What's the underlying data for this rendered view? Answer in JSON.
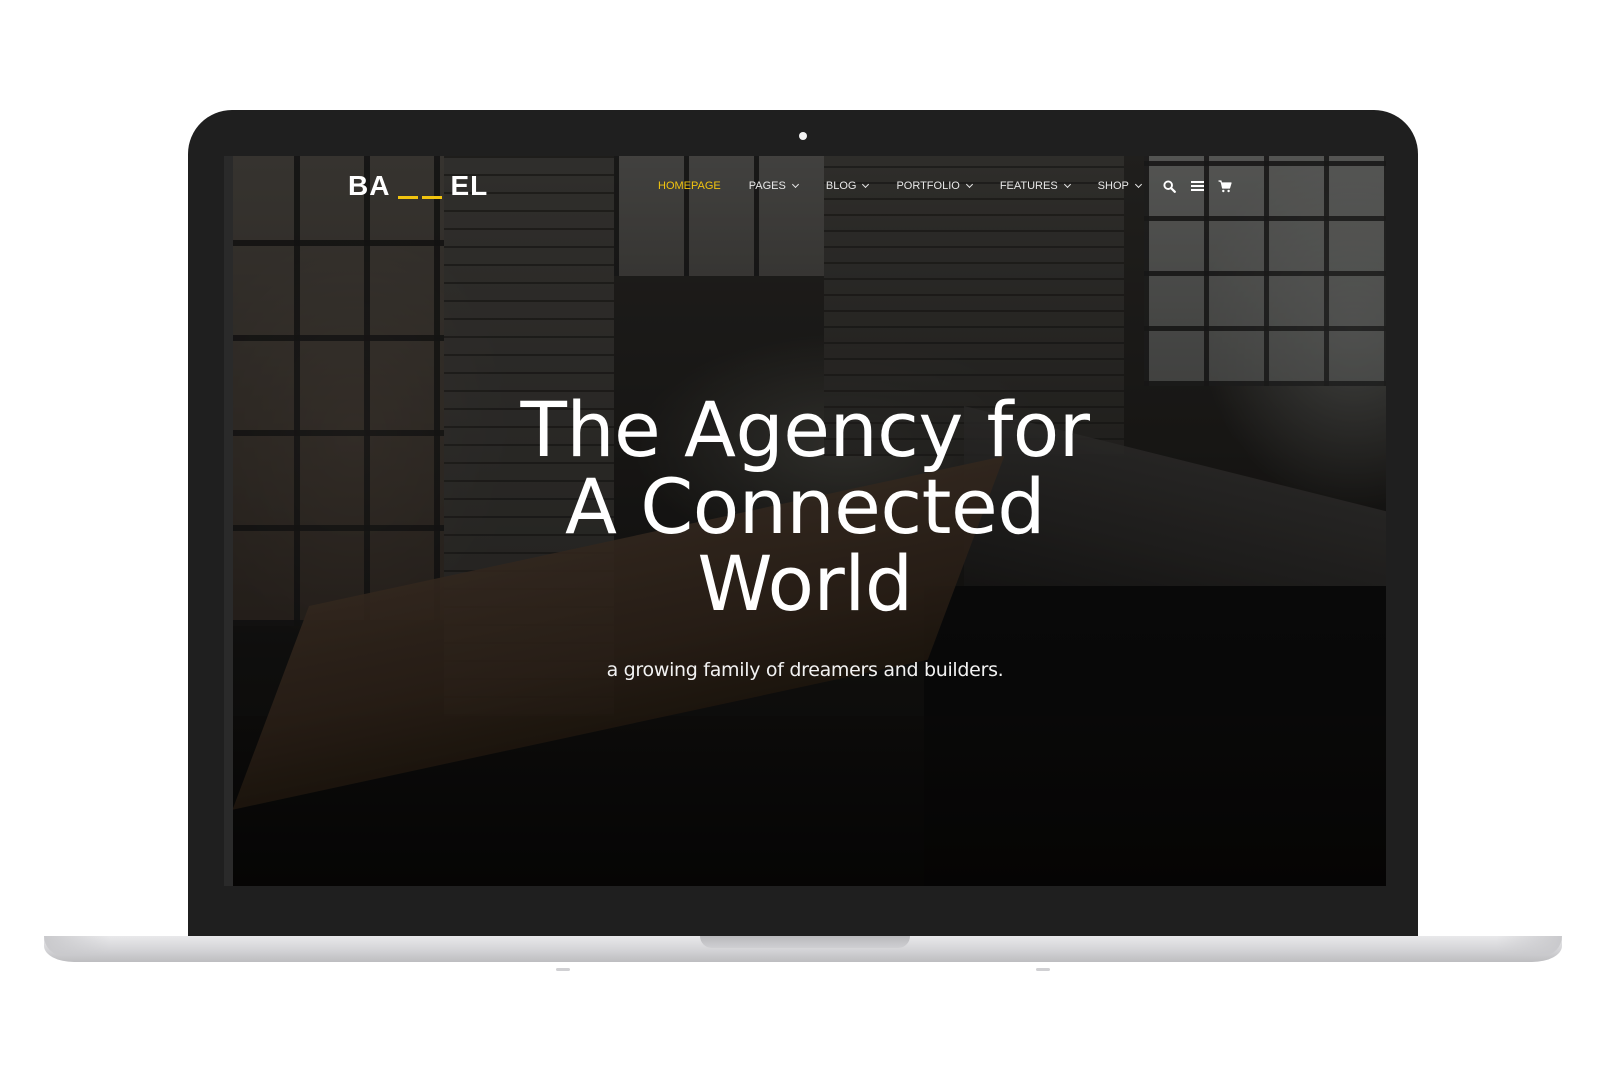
{
  "site": {
    "logo": {
      "left_text": "BA",
      "right_text": "EL",
      "accent_color": "#f1c40f"
    },
    "nav": {
      "items": [
        {
          "label": "HOMEPAGE",
          "has_dropdown": false,
          "active": true
        },
        {
          "label": "PAGES",
          "has_dropdown": true,
          "active": false
        },
        {
          "label": "BLOG",
          "has_dropdown": true,
          "active": false
        },
        {
          "label": "PORTFOLIO",
          "has_dropdown": true,
          "active": false
        },
        {
          "label": "FEATURES",
          "has_dropdown": true,
          "active": false
        },
        {
          "label": "SHOP",
          "has_dropdown": true,
          "active": false
        }
      ],
      "icons": [
        "search-icon",
        "menu-icon",
        "cart-icon"
      ],
      "active_color": "#f1c40f",
      "text_color": "#e8e8e8"
    },
    "hero": {
      "title_lines": [
        "The Agency for",
        "A Connected",
        "World"
      ],
      "subtitle": "a growing family of dreamers and builders."
    }
  },
  "device": {
    "bezel_color": "#1f1f1f",
    "base_color": "#d3d3d6"
  }
}
